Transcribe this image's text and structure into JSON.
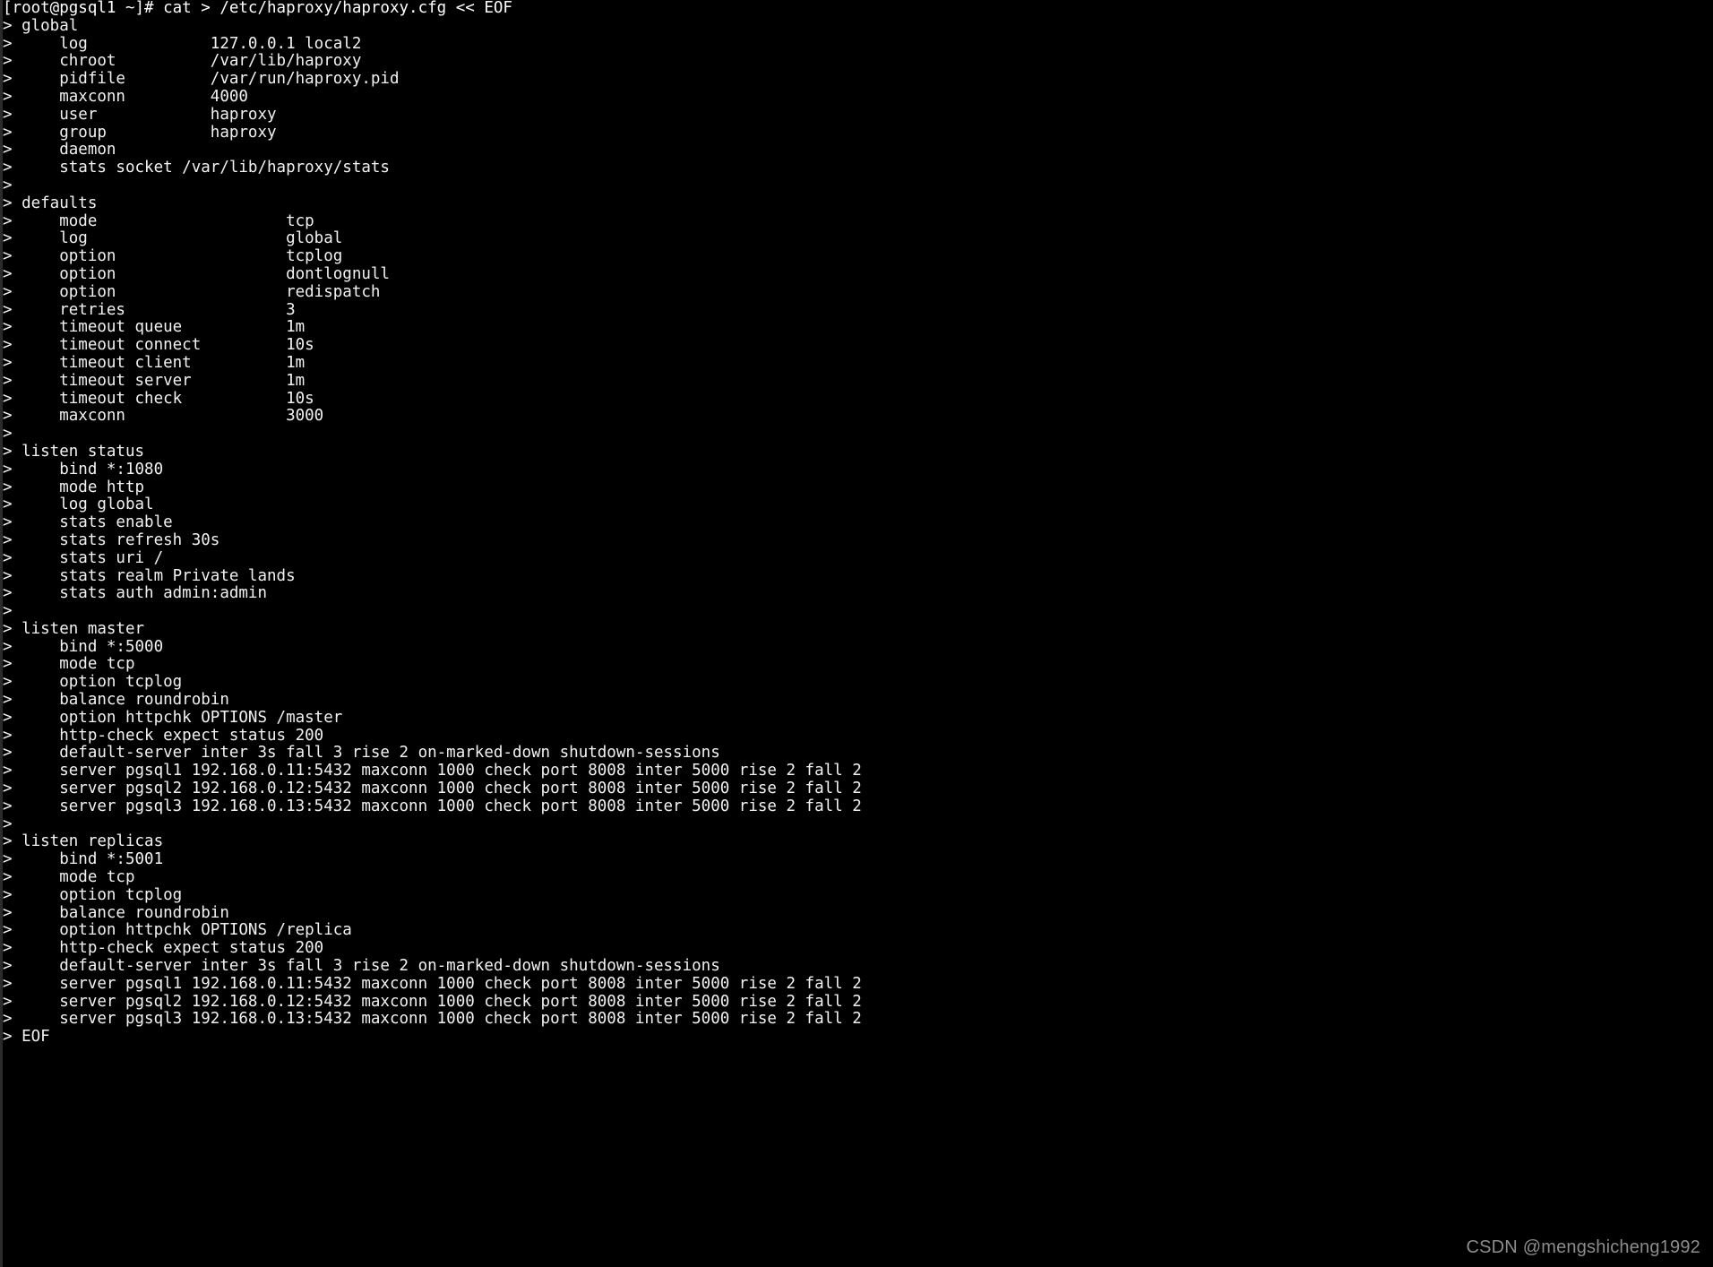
{
  "terminal": {
    "title": "Terminal",
    "prompt": "[root@pgsql1 ~]#",
    "command": " cat > /etc/haproxy/haproxy.cfg << EOF",
    "continuation_prompt": "> ",
    "background_color": "#000000",
    "foreground_color": "#e8e8e8",
    "watermark": "CSDN @mengshicheng1992",
    "first_line": "[root@pgsql1 ~]# cat > /etc/haproxy/haproxy.cfg << EOF",
    "lines": [
      "> global",
      ">     log             127.0.0.1 local2",
      ">     chroot          /var/lib/haproxy",
      ">     pidfile         /var/run/haproxy.pid",
      ">     maxconn         4000",
      ">     user            haproxy",
      ">     group           haproxy",
      ">     daemon",
      ">     stats socket /var/lib/haproxy/stats",
      ">",
      "> defaults",
      ">     mode                    tcp",
      ">     log                     global",
      ">     option                  tcplog",
      ">     option                  dontlognull",
      ">     option                  redispatch",
      ">     retries                 3",
      ">     timeout queue           1m",
      ">     timeout connect         10s",
      ">     timeout client          1m",
      ">     timeout server          1m",
      ">     timeout check           10s",
      ">     maxconn                 3000",
      ">",
      "> listen status",
      ">     bind *:1080",
      ">     mode http",
      ">     log global",
      ">     stats enable",
      ">     stats refresh 30s",
      ">     stats uri /",
      ">     stats realm Private lands",
      ">     stats auth admin:admin",
      ">",
      "> listen master",
      ">     bind *:5000",
      ">     mode tcp",
      ">     option tcplog",
      ">     balance roundrobin",
      ">     option httpchk OPTIONS /master",
      ">     http-check expect status 200",
      ">     default-server inter 3s fall 3 rise 2 on-marked-down shutdown-sessions",
      ">     server pgsql1 192.168.0.11:5432 maxconn 1000 check port 8008 inter 5000 rise 2 fall 2",
      ">     server pgsql2 192.168.0.12:5432 maxconn 1000 check port 8008 inter 5000 rise 2 fall 2",
      ">     server pgsql3 192.168.0.13:5432 maxconn 1000 check port 8008 inter 5000 rise 2 fall 2",
      ">",
      "> listen replicas",
      ">     bind *:5001",
      ">     mode tcp",
      ">     option tcplog",
      ">     balance roundrobin",
      ">     option httpchk OPTIONS /replica",
      ">     http-check expect status 200",
      ">     default-server inter 3s fall 3 rise 2 on-marked-down shutdown-sessions",
      ">     server pgsql1 192.168.0.11:5432 maxconn 1000 check port 8008 inter 5000 rise 2 fall 2",
      ">     server pgsql2 192.168.0.12:5432 maxconn 1000 check port 8008 inter 5000 rise 2 fall 2",
      ">     server pgsql3 192.168.0.13:5432 maxconn 1000 check port 8008 inter 5000 rise 2 fall 2",
      "> EOF"
    ]
  }
}
